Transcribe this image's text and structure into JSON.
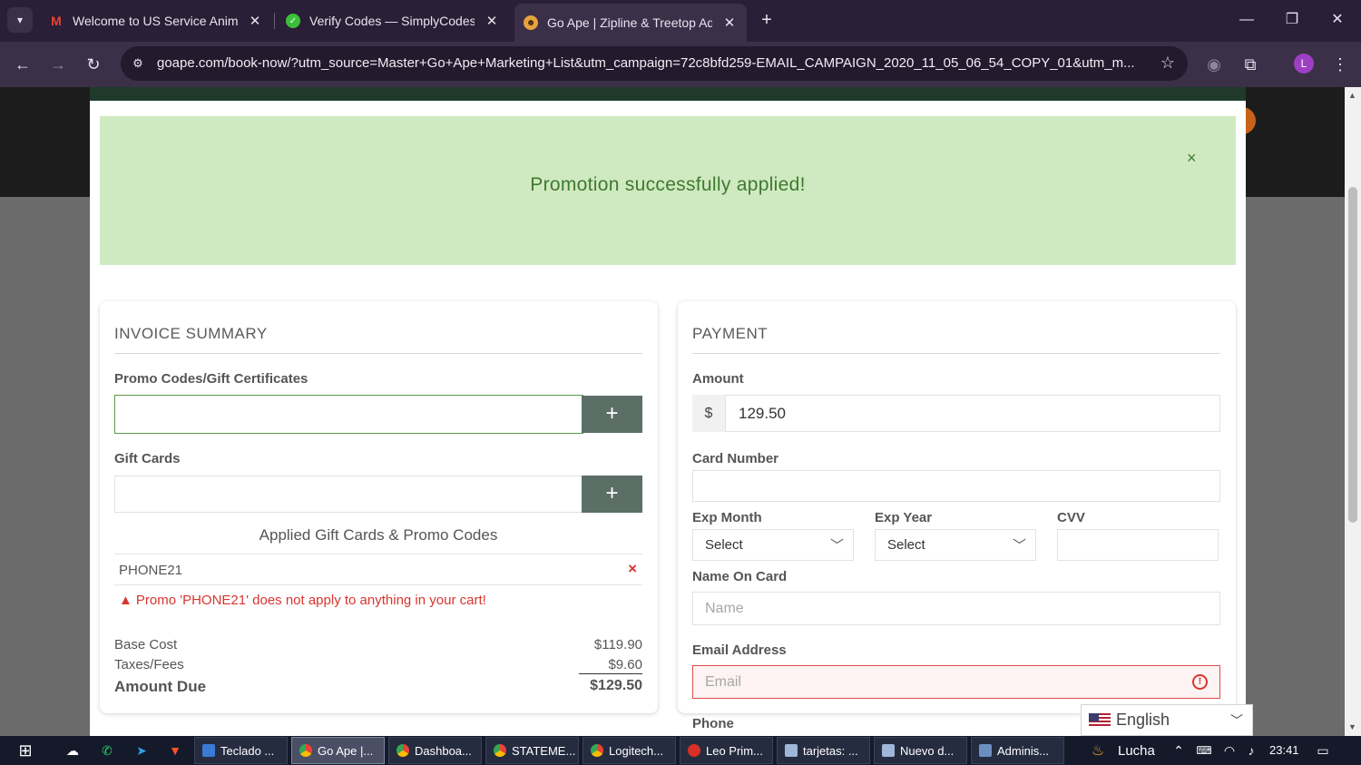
{
  "browser": {
    "tabs": [
      {
        "title": "Welcome to US Service Animals",
        "favicon": "gmail-icon",
        "color": "#ea4335"
      },
      {
        "title": "Verify Codes — SimplyCodes",
        "favicon": "simplycodes-icon",
        "color": "#3bbf3b"
      },
      {
        "title": "Go Ape | Zipline & Treetop Adv",
        "favicon": "goape-icon",
        "color": "#e8a33d"
      }
    ],
    "url": "goape.com/book-now/?utm_source=Master+Go+Ape+Marketing+List&utm_campaign=72c8bfd259-EMAIL_CAMPAIGN_2020_11_05_06_54_COPY_01&utm_m...",
    "profile_initial": "L"
  },
  "alert": {
    "message": "Promotion successfully applied!",
    "close": "×"
  },
  "invoice": {
    "heading": "INVOICE SUMMARY",
    "promo_label": "Promo Codes/Gift Certificates",
    "promo_value": "",
    "add_label": "+",
    "gift_label": "Gift Cards",
    "gift_value": "",
    "applied_heading": "Applied Gift Cards & Promo Codes",
    "applied_code": "PHONE21",
    "remove": "×",
    "warning": "Promo 'PHONE21' does not apply to anything in your cart!",
    "costs": {
      "base_label": "Base Cost",
      "base_value": "$119.90",
      "tax_label": "Taxes/Fees",
      "tax_value": "$9.60",
      "due_label": "Amount Due",
      "due_value": "$129.50"
    }
  },
  "payment": {
    "heading": "PAYMENT",
    "amount_label": "Amount",
    "currency": "$",
    "amount_value": "129.50",
    "card_label": "Card Number",
    "exp_month_label": "Exp Month",
    "exp_month_value": "Select",
    "exp_year_label": "Exp Year",
    "exp_year_value": "Select",
    "cvv_label": "CVV",
    "name_label": "Name On Card",
    "name_placeholder": "Name",
    "email_label": "Email Address",
    "email_placeholder": "Email",
    "phone_label": "Phone"
  },
  "language": {
    "selected": "English"
  },
  "taskbar": {
    "apps": [
      {
        "label": "Teclado ...",
        "active": false,
        "color": "#3a7bd5"
      },
      {
        "label": "Go Ape |...",
        "active": true,
        "color": "#e8a33d"
      },
      {
        "label": "Dashboa...",
        "active": false,
        "color": "#34a853"
      },
      {
        "label": "STATEME...",
        "active": false,
        "color": "#34a853"
      },
      {
        "label": "Logitech...",
        "active": false,
        "color": "#34a853"
      },
      {
        "label": "Leo Prim...",
        "active": false,
        "color": "#d93025"
      },
      {
        "label": "tarjetas: ...",
        "active": false,
        "color": "#9fb7d8"
      },
      {
        "label": "Nuevo d...",
        "active": false,
        "color": "#9fb7d8"
      },
      {
        "label": "Adminis...",
        "active": false,
        "color": "#6b8fc2"
      }
    ],
    "weather": "Lucha",
    "time": "23:41"
  }
}
